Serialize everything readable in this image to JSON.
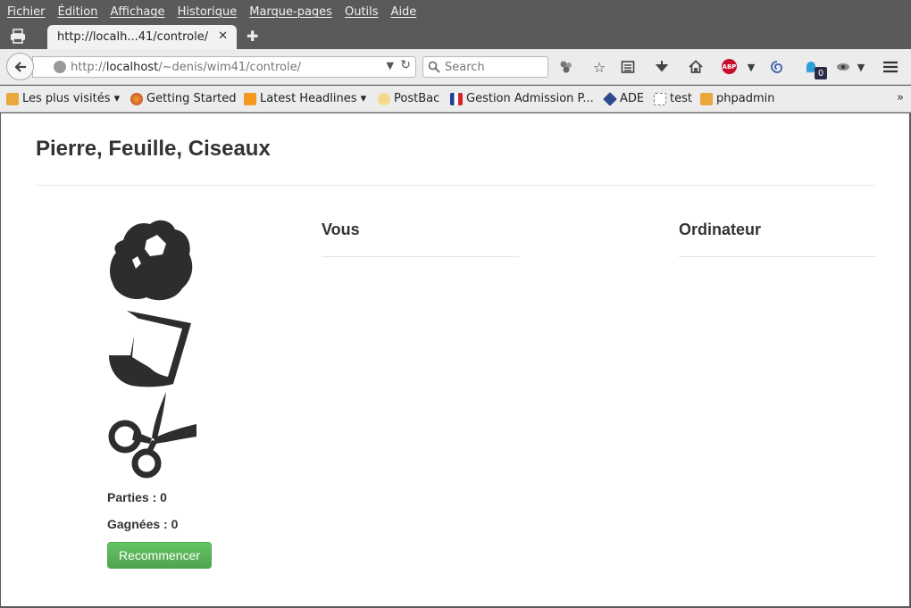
{
  "menubar": {
    "items": [
      "Fichier",
      "Édition",
      "Affichage",
      "Historique",
      "Marque-pages",
      "Outils",
      "Aide"
    ]
  },
  "tabs": [
    {
      "title": "http://localh...41/controle/"
    }
  ],
  "nav": {
    "url_prefix": "http://",
    "url_host": "localhost",
    "url_path": "/~denis/wim41/controle/",
    "search_placeholder": "Search",
    "abp_label": "ABP",
    "badge_count": "0"
  },
  "bookmarks": [
    {
      "label": "Les plus visités ▾",
      "icon": "most-visited-icon"
    },
    {
      "label": "Getting Started",
      "icon": "firefox-icon"
    },
    {
      "label": "Latest Headlines ▾",
      "icon": "rss-icon"
    },
    {
      "label": "PostBac",
      "icon": "postbac-icon"
    },
    {
      "label": "Gestion Admission P...",
      "icon": "flag-fr-icon"
    },
    {
      "label": "ADE",
      "icon": "ade-icon"
    },
    {
      "label": "test",
      "icon": "blank-page-icon"
    },
    {
      "label": "phpadmin",
      "icon": "pma-icon"
    }
  ],
  "page": {
    "title": "Pierre, Feuille, Ciseaux",
    "choices": [
      "rock-icon",
      "paper-icon",
      "scissors-icon"
    ],
    "parties_label": "Parties : 0",
    "gagnees_label": "Gagnées : 0",
    "restart_label": "Recommencer",
    "col_vous": "Vous",
    "col_ordinateur": "Ordinateur"
  },
  "colors": {
    "chrome_dark": "#5a5a5a",
    "toolbar": "#ececec",
    "restart_green": "#5cb85c",
    "text": "#333333"
  }
}
